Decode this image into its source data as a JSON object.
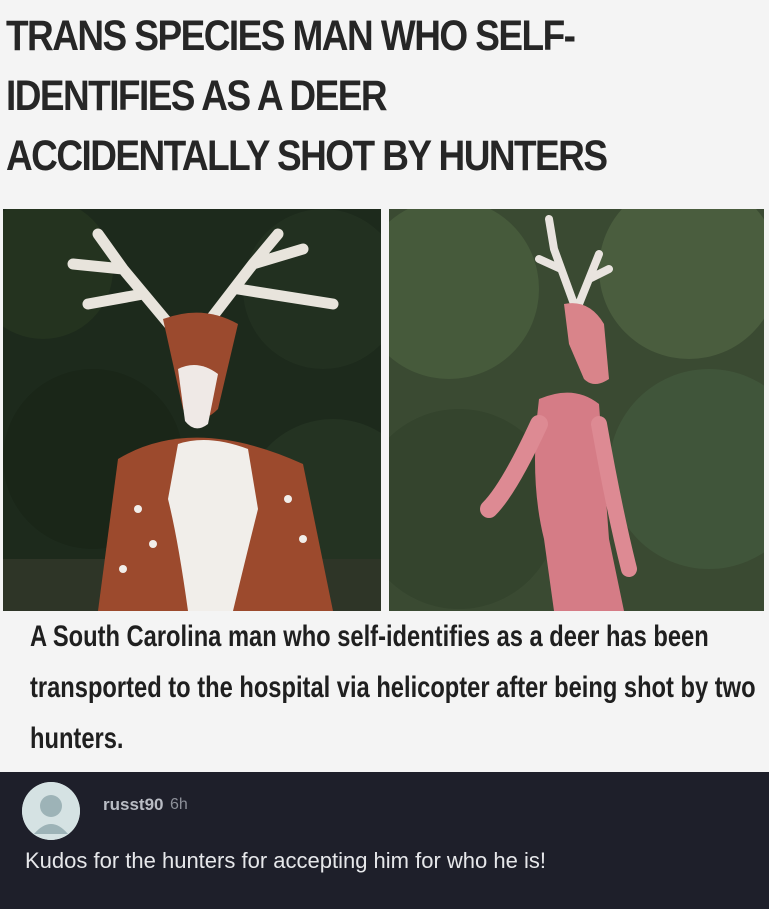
{
  "headline": "TRANS SPECIES MAN WHO SELF-\nIDENTIFIES AS A DEER\nACCIDENTALLY SHOT BY HUNTERS",
  "caption": "A South Carolina man who self-identifies as a deer has been transported to the hospital via helicopter after being shot by two hunters.",
  "comment": {
    "username": "russt90",
    "time": "6h",
    "text": "Kudos for the hunters for accepting him for who he is!"
  },
  "colors": {
    "meme_background": "#f4f4f4",
    "comment_background": "#1e1f2a",
    "username": "#b9bcc4",
    "comment_text": "#e6e7ea"
  }
}
